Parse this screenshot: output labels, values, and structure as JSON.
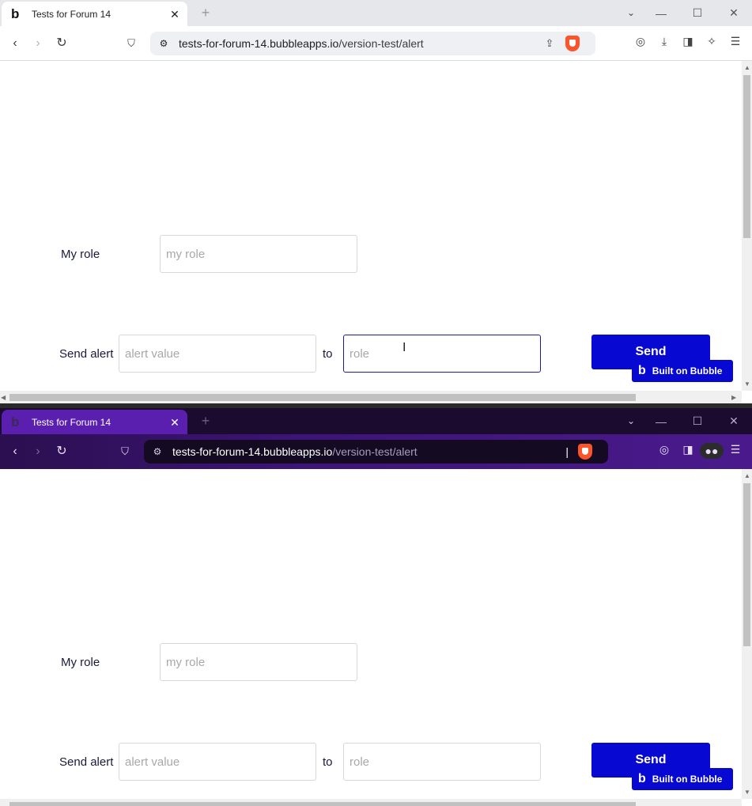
{
  "windows": [
    {
      "theme": "light",
      "tab": {
        "title": "Tests for Forum 14",
        "favicon": "b",
        "close": "✕"
      },
      "new_tab_label": "+",
      "tab_list": "⌄",
      "window_controls": {
        "minimize": "—",
        "maximize": "☐",
        "close": "✕"
      },
      "nav": {
        "back": "‹",
        "forward": "›",
        "reload": "↻",
        "bookmark": "🔖"
      },
      "url": {
        "host": "tests-for-forum-14.bubbleapps.io",
        "path": "/version-test/alert"
      },
      "page": {
        "my_role_label": "My role",
        "my_role_placeholder": "my role",
        "send_alert_label": "Send alert",
        "alert_value_placeholder": "alert value",
        "to_label": "to",
        "role_placeholder": "role",
        "send_button": "Send",
        "built_on_bubble": "Built on Bubble"
      }
    },
    {
      "theme": "dark",
      "tab": {
        "title": "Tests for Forum 14",
        "favicon": "b",
        "close": "✕"
      },
      "new_tab_label": "+",
      "tab_list": "⌄",
      "window_controls": {
        "minimize": "—",
        "maximize": "☐",
        "close": "✕"
      },
      "nav": {
        "back": "‹",
        "forward": "›",
        "reload": "↻",
        "bookmark": "🔖"
      },
      "url": {
        "host": "tests-for-forum-14.bubbleapps.io",
        "path": "/version-test/alert"
      },
      "page": {
        "my_role_label": "My role",
        "my_role_placeholder": "my role",
        "send_alert_label": "Send alert",
        "alert_value_placeholder": "alert value",
        "to_label": "to",
        "role_placeholder": "role",
        "send_button": "Send",
        "built_on_bubble": "Built on Bubble"
      }
    }
  ],
  "colors": {
    "send_button": "#0808d3",
    "dark_tab": "#5a1fae",
    "brave": "#fb542b"
  },
  "icons": [
    "bubble-favicon-icon",
    "back-icon",
    "forward-icon",
    "reload-icon",
    "bookmark-icon",
    "site-info-icon",
    "share-icon",
    "brave-shield-icon",
    "leo-icon",
    "download-icon",
    "sidebar-icon",
    "extension-icon",
    "menu-icon"
  ]
}
